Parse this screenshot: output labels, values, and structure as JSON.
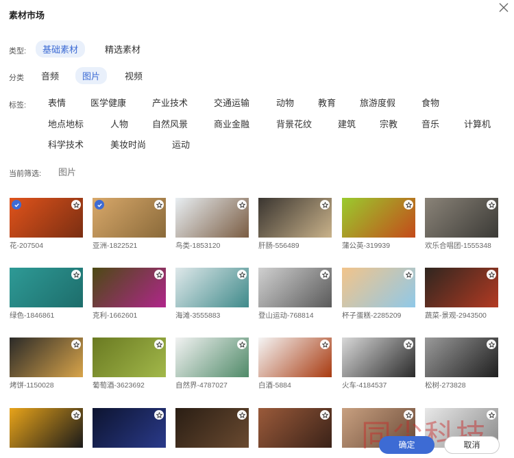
{
  "dialog": {
    "title": "素材市场"
  },
  "type_filter": {
    "label": "类型:",
    "options": [
      "基础素材",
      "精选素材"
    ]
  },
  "category_filter": {
    "label": "分类",
    "options": [
      "音频",
      "图片",
      "视频"
    ]
  },
  "tags_filter": {
    "label": "标签:",
    "tags": [
      "表情",
      "医学健康",
      "产业技术",
      "交通运输",
      "动物",
      "教育",
      "旅游度假",
      "食物",
      "地点地标",
      "人物",
      "自然风景",
      "商业金融",
      "背景花纹",
      "建筑",
      "宗教",
      "音乐",
      "计算机",
      "科学技术",
      "美妆时尚",
      "运动"
    ]
  },
  "current_filter": {
    "label": "当前筛选:",
    "value": "图片"
  },
  "assets": [
    {
      "caption": "花-207504",
      "selected": true,
      "colors": [
        "#e0531b",
        "#7a2e12"
      ]
    },
    {
      "caption": "亚洲-1822521",
      "selected": true,
      "colors": [
        "#d8a86a",
        "#8a6a3a"
      ]
    },
    {
      "caption": "鸟类-1853120",
      "selected": false,
      "colors": [
        "#e8eef2",
        "#7a5c42"
      ]
    },
    {
      "caption": "肝肠-556489",
      "selected": false,
      "colors": [
        "#3a3530",
        "#c9b28a"
      ]
    },
    {
      "caption": "蒲公英-319939",
      "selected": false,
      "colors": [
        "#9acb2e",
        "#c44a1a"
      ]
    },
    {
      "caption": "欢乐合唱团-1555348",
      "selected": false,
      "colors": [
        "#8a8378",
        "#3b3a36"
      ]
    },
    {
      "caption": "绿色-1846861",
      "selected": false,
      "colors": [
        "#2e9a96",
        "#1d6d6b"
      ]
    },
    {
      "caption": "克利-1662601",
      "selected": false,
      "colors": [
        "#4c4a14",
        "#b0268a"
      ]
    },
    {
      "caption": "海滩-3555883",
      "selected": false,
      "colors": [
        "#dfe8ea",
        "#3f8a8a"
      ]
    },
    {
      "caption": "登山运动-768814",
      "selected": false,
      "colors": [
        "#d0d0d0",
        "#5a5a5a"
      ]
    },
    {
      "caption": "杯子蛋糕-2285209",
      "selected": false,
      "colors": [
        "#f2c48a",
        "#8fc8e8"
      ]
    },
    {
      "caption": "蔬菜-景观-2943500",
      "selected": false,
      "colors": [
        "#2f2620",
        "#b33a22"
      ]
    },
    {
      "caption": "烤饼-1150028",
      "selected": false,
      "colors": [
        "#2b2a28",
        "#d8a44a"
      ]
    },
    {
      "caption": "葡萄酒-3623692",
      "selected": false,
      "colors": [
        "#6a7a22",
        "#a2b84a"
      ]
    },
    {
      "caption": "自然界-4787027",
      "selected": false,
      "colors": [
        "#f2f2f2",
        "#4f8a68"
      ]
    },
    {
      "caption": "白酒-5884",
      "selected": false,
      "colors": [
        "#f5f5f5",
        "#a83a10"
      ]
    },
    {
      "caption": "火车-4184537",
      "selected": false,
      "colors": [
        "#d8d8d8",
        "#2a2a2a"
      ]
    },
    {
      "caption": "松树-273828",
      "selected": false,
      "colors": [
        "#9a9a9a",
        "#1f1f1f"
      ]
    },
    {
      "caption": "",
      "selected": false,
      "colors": [
        "#e8a41a",
        "#1a1a1a"
      ]
    },
    {
      "caption": "",
      "selected": false,
      "colors": [
        "#0d1430",
        "#2a3a8a"
      ]
    },
    {
      "caption": "",
      "selected": false,
      "colors": [
        "#2a1e14",
        "#6a4a30"
      ]
    },
    {
      "caption": "",
      "selected": false,
      "colors": [
        "#9a5a3a",
        "#3a2218"
      ]
    },
    {
      "caption": "",
      "selected": false,
      "colors": [
        "#c8a080",
        "#6a4a38"
      ]
    },
    {
      "caption": "",
      "selected": false,
      "colors": [
        "#e8e8e8",
        "#8a8a8a"
      ]
    }
  ],
  "watermark": "同尘科技",
  "actions": {
    "ok_label": "确定",
    "cancel_label": "取消"
  },
  "theme": {
    "accent": "#3d6bd4",
    "chip_bg": "#e9f0fb"
  }
}
